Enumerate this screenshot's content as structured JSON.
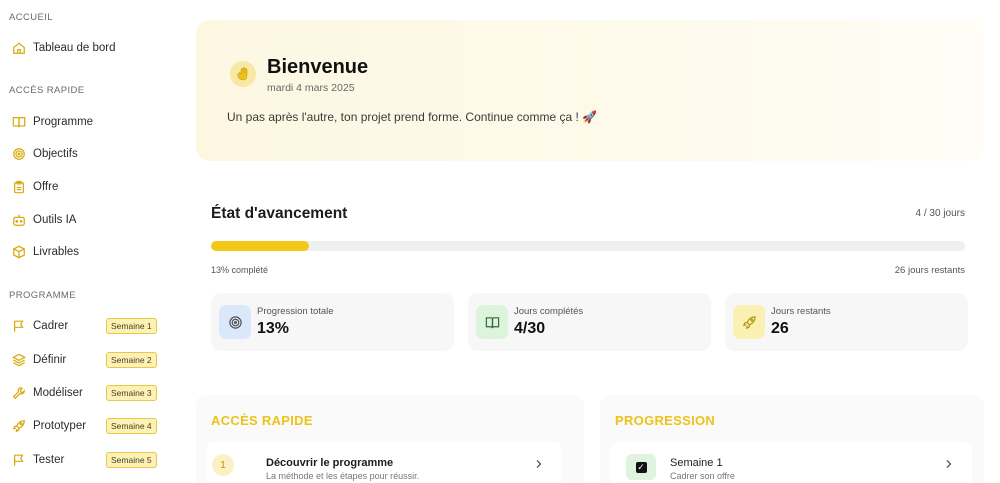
{
  "sidebar": {
    "sections": {
      "accueil": "ACCUEIL",
      "acces_rapide": "ACCÈS RAPIDE",
      "programme": "PROGRAMME"
    },
    "accueil_items": [
      {
        "label": "Tableau de bord",
        "icon": "home-icon"
      }
    ],
    "acces_items": [
      {
        "label": "Programme",
        "icon": "book-open-icon"
      },
      {
        "label": "Objectifs",
        "icon": "target-icon"
      },
      {
        "label": "Offre",
        "icon": "clipboard-icon"
      },
      {
        "label": "Outils IA",
        "icon": "robot-icon"
      },
      {
        "label": "Livrables",
        "icon": "package-icon"
      }
    ],
    "programme_items": [
      {
        "label": "Cadrer",
        "badge": "Semaine 1",
        "icon": "flag-icon"
      },
      {
        "label": "Définir",
        "badge": "Semaine 2",
        "icon": "layers-icon"
      },
      {
        "label": "Modéliser",
        "badge": "Semaine 3",
        "icon": "wrench-icon"
      },
      {
        "label": "Prototyper",
        "badge": "Semaine 4",
        "icon": "rocket-icon"
      },
      {
        "label": "Tester",
        "badge": "Semaine 5",
        "icon": "flag-icon"
      }
    ]
  },
  "hero": {
    "avatar_icon": "waving-hand-icon",
    "title": "Bienvenue",
    "date": "mardi 4 mars 2025",
    "message": "Un pas après l'autre, ton projet prend forme. Continue comme ça ! 🚀"
  },
  "progress": {
    "title": "État d'avancement",
    "days": "4 / 30 jours",
    "fraction": 0.13,
    "completed_label": "13% complété",
    "remaining_label": "26 jours restants",
    "stats": [
      {
        "label": "Progression totale",
        "value": "13%",
        "icon": "target-icon",
        "color": "#dbe8fb"
      },
      {
        "label": "Jours complétés",
        "value": "4/30",
        "icon": "book-open-icon",
        "color": "#dcf3dc"
      },
      {
        "label": "Jours restants",
        "value": "26",
        "icon": "rocket-icon",
        "color": "#fbf0b4"
      }
    ]
  },
  "quick_access": {
    "title": "ACCÈS RAPIDE",
    "items": [
      {
        "num": "1",
        "title": "Découvrir le programme",
        "subtitle": "La méthode et les étapes pour réussir."
      }
    ]
  },
  "progression": {
    "title": "PROGRESSION",
    "items": [
      {
        "title": "Semaine 1",
        "subtitle": "Cadrer son offre",
        "done": "✓"
      }
    ]
  },
  "colors": {
    "accent": "#f3c818",
    "accent_text": "#eec21b"
  }
}
